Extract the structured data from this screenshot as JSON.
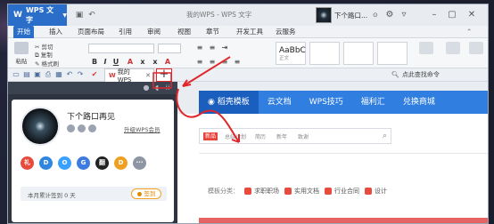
{
  "titlebar": {
    "app_button": "WPS 文字",
    "window_title": "我的WPS - WPS 文字",
    "user_name": "下个路口..."
  },
  "menu": {
    "tabs": [
      "开始",
      "插入",
      "页面布局",
      "引用",
      "审阅",
      "视图",
      "章节",
      "开发工具",
      "云服务"
    ]
  },
  "ribbon": {
    "paste": "粘贴",
    "cut": "剪切",
    "copy": "复制",
    "format_painter": "格式刷",
    "style_sample": "AaBbC",
    "style_name": "正文"
  },
  "quickbar": {
    "doc_tab": "我的WPS",
    "new_tab": "+",
    "find_cmd": "点此查找命令"
  },
  "leftpanel": {
    "user_name": "下个路口再见",
    "upgrade": "升级WPS会员",
    "apps": [
      "礼",
      "D",
      "O",
      "G",
      "翻",
      "D",
      "···"
    ],
    "app_colors": [
      "#e84a3c",
      "#2e86de",
      "#3aa0ff",
      "#3d7be0",
      "#222222",
      "#f0a020",
      "#8e96a3"
    ],
    "sign_text": "本月累计签到 0 天",
    "sign_button": "签到"
  },
  "content": {
    "nav": [
      "稻壳模板",
      "云文档",
      "WPS技巧",
      "福利汇",
      "兑换商城"
    ],
    "search_tags": [
      "新品",
      "总结计划",
      "简历",
      "新年",
      "致谢"
    ],
    "search_first": "新品",
    "category_label": "模板分类：",
    "categories": [
      "求职职场",
      "实用文档",
      "行业合同",
      "设计"
    ]
  }
}
